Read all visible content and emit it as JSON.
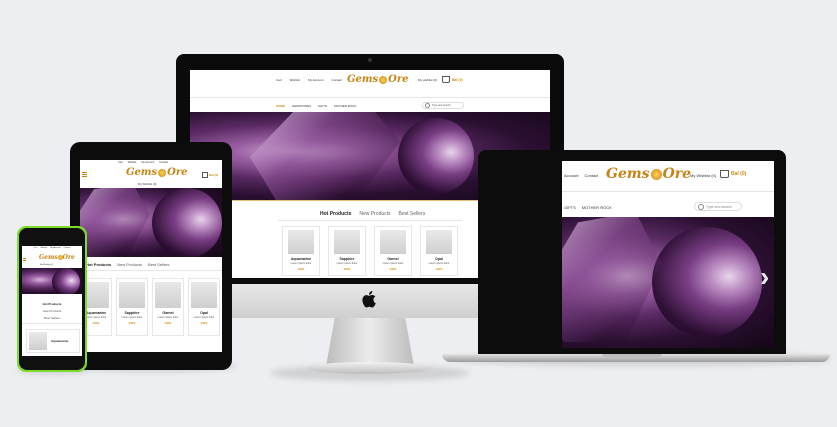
{
  "colors": {
    "page_bg": "#eceef1",
    "accent_gold": "#d18a12",
    "device_black": "#111111",
    "phone_green": "#7ddc2b"
  },
  "brand": {
    "logo_text": "Gems",
    "logo_text_2": "Ore"
  },
  "desktop": {
    "nav_links": [
      "Cart",
      "Wishlist",
      "My Account",
      "Contact"
    ],
    "account_label": "My wishlist (0)",
    "cart_label": "Bal (0)",
    "menu": [
      "HOME",
      "GEMSTONES",
      "GIFTS",
      "MOTHER ROCK"
    ],
    "search_placeholder": "Type and search",
    "tabs": [
      "Hot Products",
      "New Products",
      "Best Sellers"
    ],
    "products": [
      {
        "name": "Aquamarine",
        "sub": "Lorem ipsum dolor",
        "price": "$$$$"
      },
      {
        "name": "Sapphire",
        "sub": "Lorem ipsum dolor",
        "price": "$$$$"
      },
      {
        "name": "Garnet",
        "sub": "Lorem ipsum dolor",
        "price": "$$$$"
      },
      {
        "name": "Opal",
        "sub": "Lorem ipsum dolor",
        "price": "$$$$"
      }
    ]
  },
  "laptop": {
    "nav_links": [
      "Account",
      "Contact"
    ],
    "account_label": "My Wishlist (0)",
    "cart_label": "Bal (0)",
    "menu": [
      "GIFTS",
      "MOTHER ROCK"
    ],
    "search_placeholder": "Type and search"
  },
  "tablet": {
    "nav_links": [
      "Cart",
      "Wishlist",
      "My Account",
      "Contact"
    ],
    "account_label": "My Wishlist (0)",
    "cart_label": "Bal (0)",
    "tabs": [
      "Hot Products",
      "New Products",
      "Best Sellers"
    ],
    "products": [
      {
        "name": "Aquamarine",
        "sub": "Lorem ipsum dolor",
        "price": "$$$$"
      },
      {
        "name": "Sapphire",
        "sub": "Lorem ipsum dolor",
        "price": "$$$$"
      },
      {
        "name": "Garnet",
        "sub": "Lorem ipsum dolor",
        "price": "$$$$"
      },
      {
        "name": "Opal",
        "sub": "Lorem ipsum dolor",
        "price": "$$$$"
      }
    ]
  },
  "phone": {
    "nav_links": [
      "Cart",
      "Wishlist",
      "My Account",
      "Contact"
    ],
    "account_label": "My Wishlist (0)",
    "tabs": [
      "Hot Products",
      "New Products",
      "Best Sellers"
    ],
    "product": {
      "name": "Aquamarine"
    }
  }
}
